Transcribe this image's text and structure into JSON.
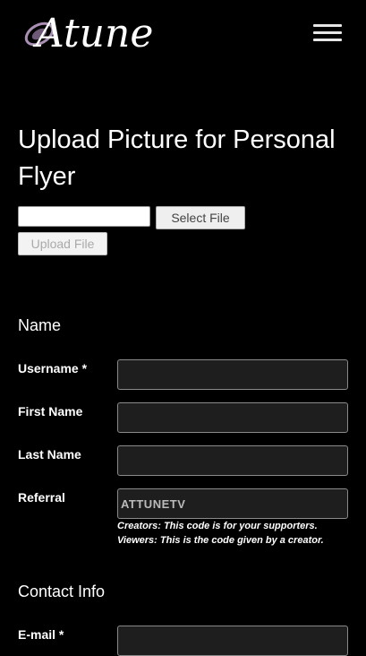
{
  "header": {
    "logo_text": "Atune",
    "logo_icon": "atune-swirl-logo",
    "menu_icon": "hamburger-menu-icon"
  },
  "upload": {
    "title": "Upload Picture for Personal Flyer",
    "file_path_value": "",
    "select_label": "Select File",
    "upload_label": "Upload File"
  },
  "name_section": {
    "title": "Name",
    "username_label": "Username *",
    "username_value": "",
    "first_name_label": "First Name",
    "first_name_value": "",
    "last_name_label": "Last Name",
    "last_name_value": "",
    "referral_label": "Referral",
    "referral_value": "ATTUNETV",
    "referral_note_creators": "Creators: This code is for your supporters.",
    "referral_note_viewers": "Viewers: This is the code given by a creator."
  },
  "contact_section": {
    "title": "Contact Info",
    "email_label": "E-mail *",
    "email_value": ""
  },
  "colors": {
    "background": "#000000",
    "text": "#ffffff",
    "input_background": "#1e1e1e",
    "input_border": "#8a8a8a",
    "logo_accent": "#a98fb3"
  }
}
